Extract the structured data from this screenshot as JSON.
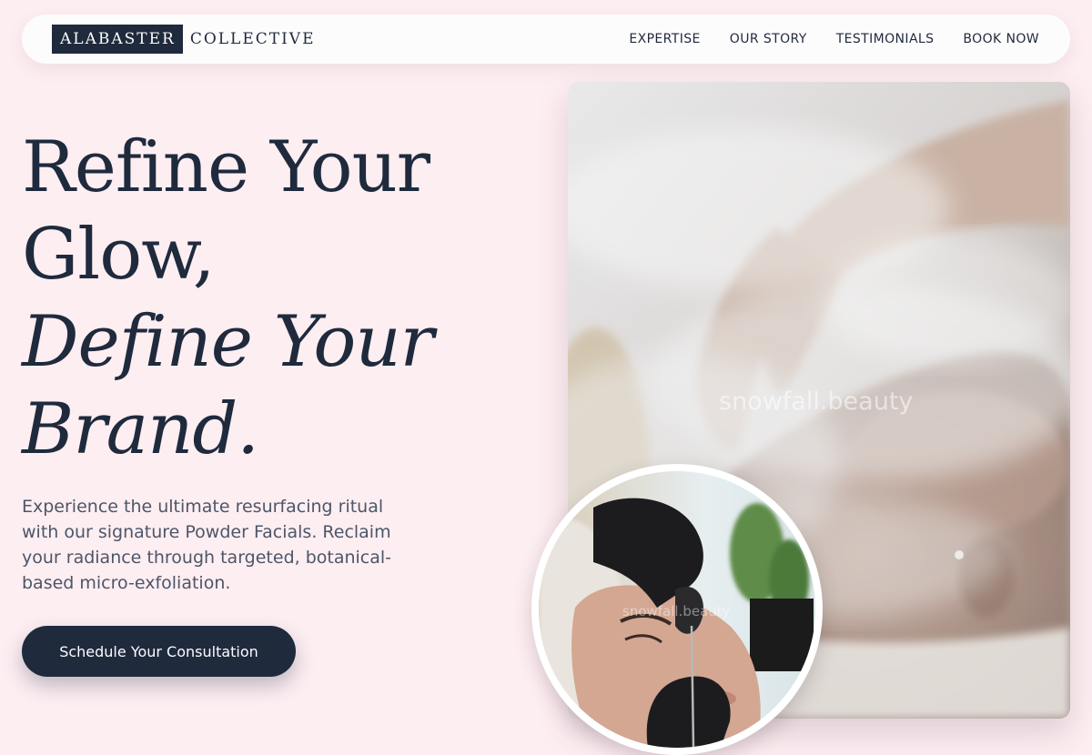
{
  "brand": {
    "logo_primary": "ALABASTER",
    "logo_secondary": "COLLECTIVE"
  },
  "nav": {
    "links": [
      {
        "label": "EXPERTISE"
      },
      {
        "label": "OUR STORY"
      },
      {
        "label": "TESTIMONIALS"
      },
      {
        "label": "BOOK NOW"
      }
    ]
  },
  "hero": {
    "headline_line1": "Refine Your",
    "headline_line2": "Glow,",
    "headline_line3": "Define Your",
    "headline_line4": "Brand.",
    "subtext": "Experience the ultimate resurfacing ritual with our signature Powder Facials. Reclaim your radiance through targeted, botanical-based micro-exfoliation.",
    "cta_label": "Schedule Your Consultation"
  },
  "media": {
    "main_photo_watermark": "snowfall.beauty",
    "circle_photo_watermark": "snowfall.beauty"
  },
  "colors": {
    "background": "#fdeef2",
    "navy": "#1f2a3d",
    "nav_bg": "#fdfcfd",
    "body_text": "#4d5668"
  }
}
